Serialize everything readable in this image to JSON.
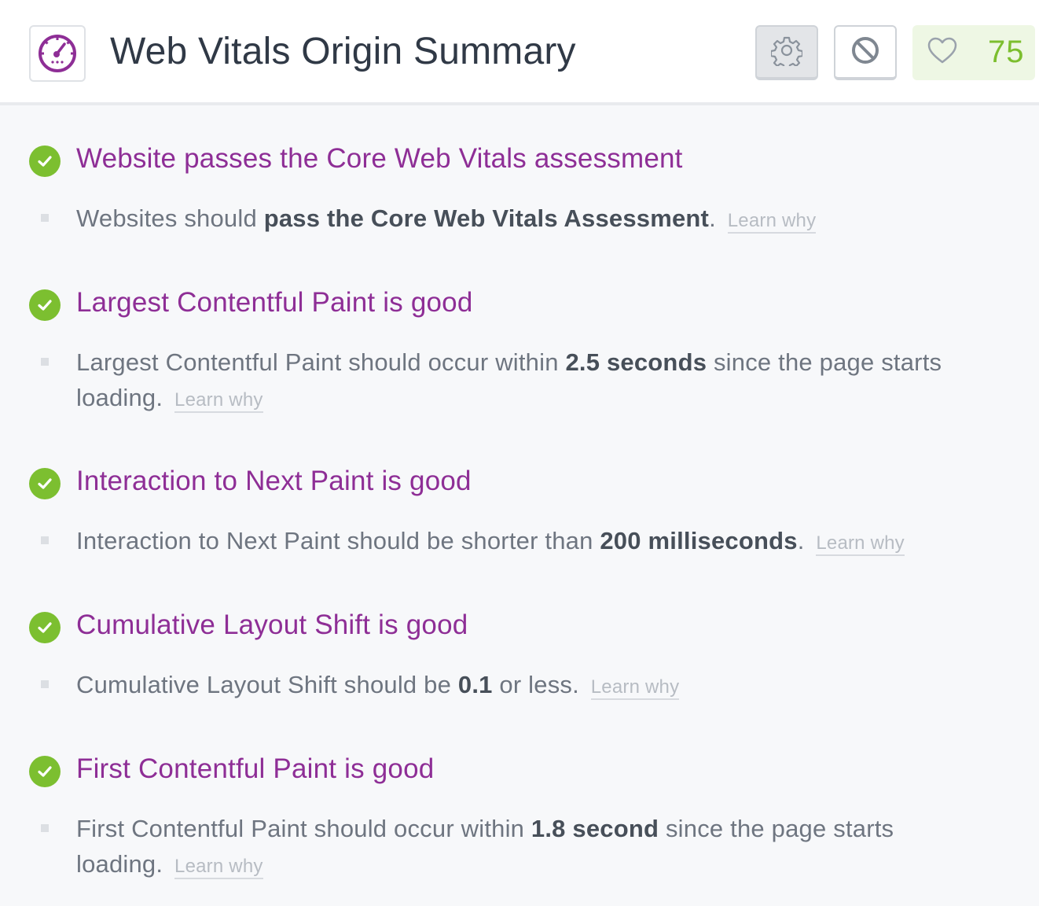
{
  "header": {
    "title": "Web Vitals Origin Summary",
    "logo_icon": "speedometer-icon",
    "settings_icon": "gear-icon",
    "disable_icon": "block-icon",
    "favorite_icon": "heart-icon",
    "score": "75"
  },
  "colors": {
    "accent": "#8e2e96",
    "pass": "#7cbf30",
    "score": "#7cbe2e"
  },
  "learn_why_label": "Learn why",
  "sections": [
    {
      "status": "pass",
      "title": "Website passes the Core Web Vitals assessment",
      "desc_pre": "Websites should ",
      "desc_bold": "pass the Core Web Vitals Assessment",
      "desc_post": ".",
      "learn": "Learn why"
    },
    {
      "status": "pass",
      "title": "Largest Contentful Paint is good",
      "desc_pre": "Largest Contentful Paint should occur within ",
      "desc_bold": "2.5 seconds",
      "desc_post": " since the page starts loading.",
      "learn": "Learn why"
    },
    {
      "status": "pass",
      "title": "Interaction to Next Paint is good",
      "desc_pre": "Interaction to Next Paint should be shorter than ",
      "desc_bold": "200 milliseconds",
      "desc_post": ".",
      "learn": "Learn why"
    },
    {
      "status": "pass",
      "title": "Cumulative Layout Shift is good",
      "desc_pre": "Cumulative Layout Shift should be ",
      "desc_bold": "0.1",
      "desc_post": " or less.",
      "learn": "Learn why"
    },
    {
      "status": "pass",
      "title": "First Contentful Paint is good",
      "desc_pre": "First Contentful Paint should occur within ",
      "desc_bold": "1.8 second",
      "desc_post": " since the page starts loading.",
      "learn": "Learn why"
    }
  ]
}
